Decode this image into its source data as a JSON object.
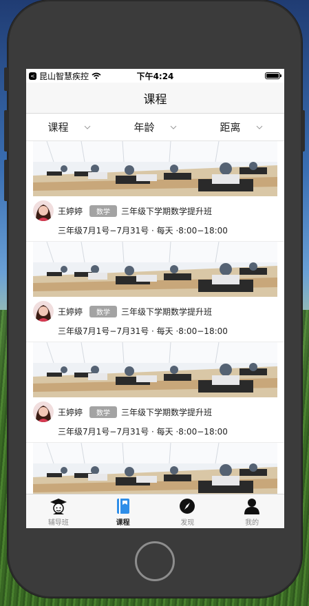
{
  "status_bar": {
    "carrier": "昆山智慧疾控",
    "time": "下午4:24",
    "back_glyph": "<"
  },
  "navbar": {
    "title": "课程"
  },
  "filters": [
    {
      "label": "课程",
      "icon": "chevron-down-icon"
    },
    {
      "label": "年龄",
      "icon": "chevron-down-icon"
    },
    {
      "label": "距离",
      "icon": "chevron-down-icon"
    }
  ],
  "courses": [
    {
      "teacher": "王婷婷",
      "subject": "数学",
      "title": "三年级下学期数学提升班",
      "schedule": "三年级7月1号−7月31号 · 每天 ·8:00−18:00"
    },
    {
      "teacher": "王婷婷",
      "subject": "数学",
      "title": "三年级下学期数学提升班",
      "schedule": "三年级7月1号−7月31号 · 每天 ·8:00−18:00"
    },
    {
      "teacher": "王婷婷",
      "subject": "数学",
      "title": "三年级下学期数学提升班",
      "schedule": "三年级7月1号−7月31号 · 每天 ·8:00−18:00"
    },
    {
      "teacher": "",
      "subject": "",
      "title": "",
      "schedule": ""
    }
  ],
  "tabbar": [
    {
      "label": "辅导班",
      "icon": "graduate-icon",
      "active": false
    },
    {
      "label": "课程",
      "icon": "book-icon",
      "active": true
    },
    {
      "label": "发现",
      "icon": "compass-icon",
      "active": false
    },
    {
      "label": "我的",
      "icon": "person-icon",
      "active": false
    }
  ],
  "colors": {
    "accent": "#2f8ee8",
    "tag_bg": "#a3a3a3",
    "tab_inactive": "#8a8a8a"
  }
}
